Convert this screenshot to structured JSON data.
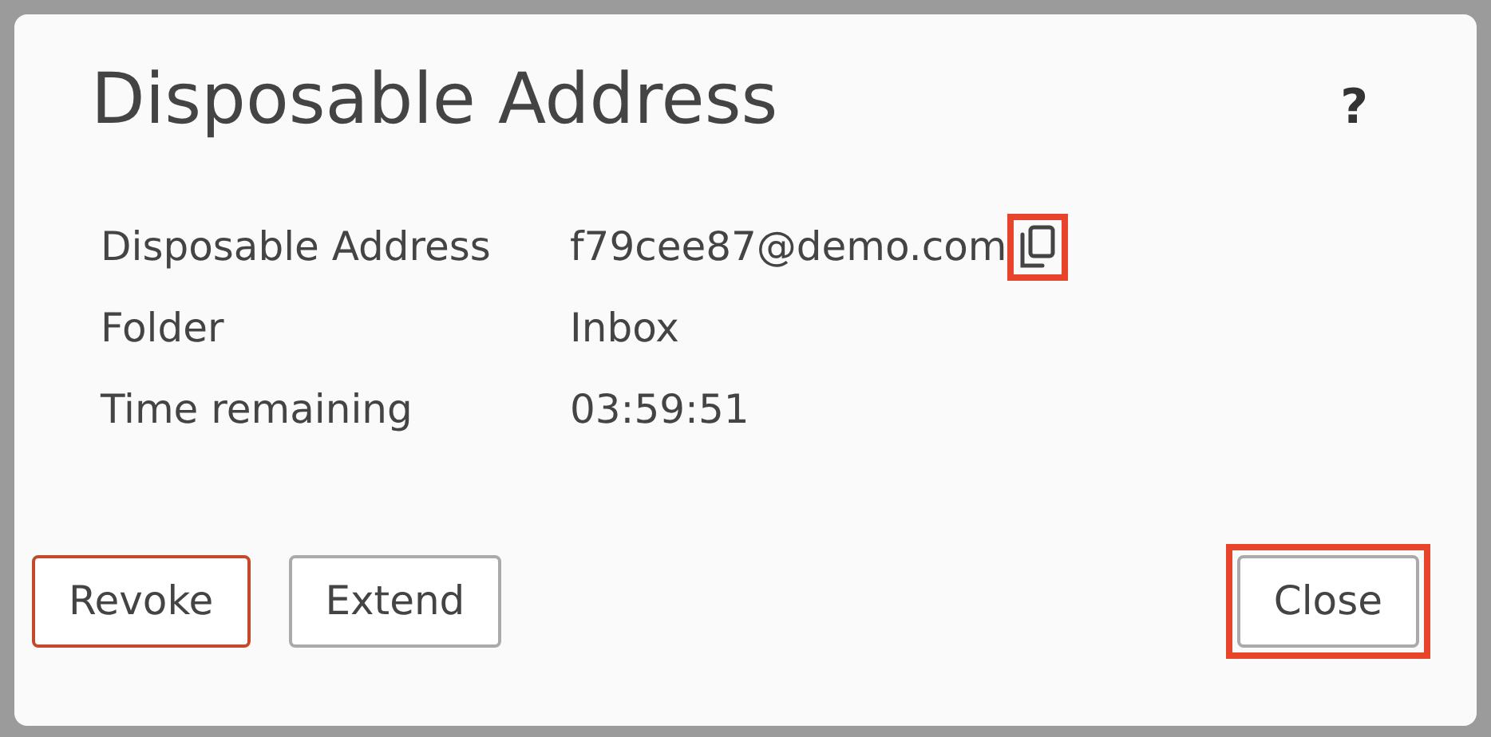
{
  "dialog": {
    "title": "Disposable Address",
    "help": "?"
  },
  "fields": [
    {
      "label": "Disposable Address",
      "value": "f79cee87@demo.com",
      "copy_icon": true,
      "highlighted": true
    },
    {
      "label": "Folder",
      "value": "Inbox",
      "copy_icon": false,
      "highlighted": false
    },
    {
      "label": "Time remaining",
      "value": "03:59:51",
      "copy_icon": false,
      "highlighted": false
    }
  ],
  "left_buttons": [
    {
      "label": "Revoke",
      "kind": "danger",
      "highlighted": false
    },
    {
      "label": "Extend",
      "kind": "default",
      "highlighted": false
    }
  ],
  "right_buttons": [
    {
      "label": "Close",
      "kind": "default",
      "highlighted": true
    }
  ]
}
